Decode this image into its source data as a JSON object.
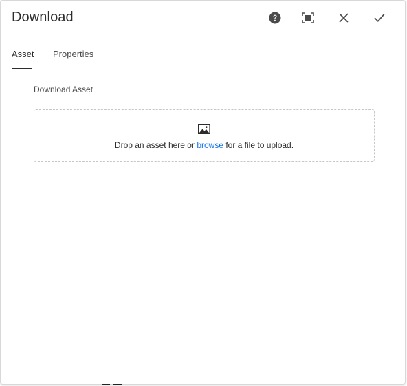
{
  "dialog": {
    "title": "Download",
    "header_icons": {
      "help": "help-icon",
      "fullscreen": "fullscreen-icon",
      "close": "close-icon",
      "done": "checkmark-icon"
    }
  },
  "tabs": [
    {
      "label": "Asset",
      "selected": true
    },
    {
      "label": "Properties",
      "selected": false
    }
  ],
  "asset_field": {
    "label": "Download Asset",
    "dropzone": {
      "icon": "image-icon",
      "text_before": "Drop an asset here or ",
      "link_text": "browse",
      "text_after": " for a file to upload."
    }
  },
  "colors": {
    "accent_link": "#1473e6",
    "text": "#2c2c2c",
    "border": "#c6c6c6"
  }
}
